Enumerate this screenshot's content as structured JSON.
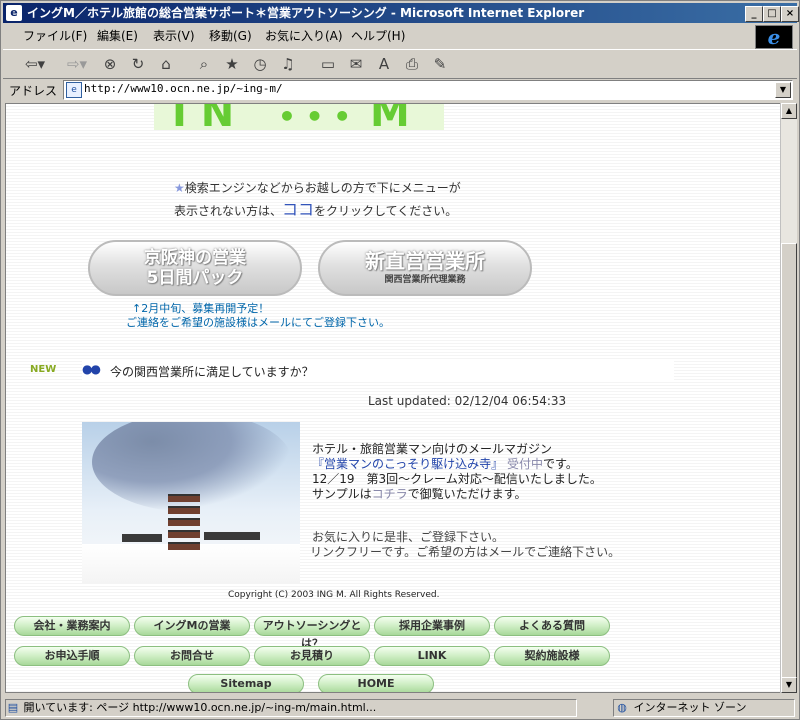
{
  "window": {
    "title": "イングM／ホテル旅館の総合営業サポート＊営業アウトソーシング - Microsoft Internet Explorer",
    "minimize": "_",
    "maximize": "□",
    "close": "×"
  },
  "menu": [
    "ファイル(F)",
    "編集(E)",
    "表示(V)",
    "移動(G)",
    "お気に入り(A)",
    "ヘルプ(H)"
  ],
  "address": {
    "label": "アドレス",
    "url": "http://www10.ocn.ne.jp/~ing-m/"
  },
  "page": {
    "notice_star": "★",
    "notice_pre": "検索エンジンなどからお越しの方で下にメニューが表示されない方は、",
    "notice_koko": "ココ",
    "notice_post": "をクリックしてください。",
    "btn_keihanshin_l1": "京阪神の営業",
    "btn_keihanshin_l2": "5日間パック",
    "btn_shinchoku_l1": "新直営営業所",
    "btn_shinchoku_l2": "関西営業所代理業務",
    "announce_l1": "↑2月中旬、募集再開予定！",
    "announce_l2": "ご連絡をご希望の施設様はメールにてご登録下さい。",
    "new_badge": "NEW",
    "new_dots": "●●",
    "new_text": "今の関西営業所に満足していますか？",
    "last_updated": "Last updated: 02/12/04 06:54:33",
    "mag_l1": "ホテル・旅館営業マン向けのメールマガジン",
    "mag_title": "『営業マンのこっそり駆け込み寺』",
    "mag_status": "受付中",
    "mag_title_suffix": "です。",
    "mag_l3": "12／19　第3回～クレーム対応～配信いたしました。",
    "mag_l4_pre": "サンプルは",
    "mag_l4_link": "コチラ",
    "mag_l4_post": "で御覧いただけます。",
    "fav_l1": "お気に入りに是非、ご登録下さい。",
    "fav_l2": "リンクフリーです。ご希望の方はメールでご連絡下さい。",
    "copyright": "Copyright (C) 2003 ING M. All Rights Reserved."
  },
  "nav_row1": [
    "会社・業務案内",
    "イングMの営業",
    "アウトソーシングとは？",
    "採用企業事例",
    "よくある質問"
  ],
  "nav_row2": [
    "お申込手順",
    "お問合せ",
    "お見積り",
    "LINK",
    "契約施設様"
  ],
  "nav_row3": [
    "Sitemap",
    "HOME"
  ],
  "status": {
    "text": "開いています: ページ http://www10.ocn.ne.jp/~ing-m/main.html...",
    "zone": "インターネット ゾーン"
  }
}
